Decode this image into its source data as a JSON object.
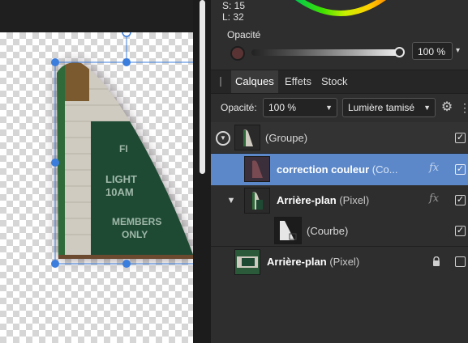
{
  "color_panel": {
    "saturation": "S: 15",
    "lightness": "L: 32",
    "opacity_label": "Opacité",
    "opacity_value": "100 %",
    "opacity_fraction": 1.0,
    "swatch_color": "#5a3434"
  },
  "tabs": [
    {
      "label": "Calques",
      "active": true
    },
    {
      "label": "Effets",
      "active": false
    },
    {
      "label": "Stock",
      "active": false
    }
  ],
  "layer_toolbar": {
    "opacity_label": "Opacité:",
    "opacity_value": "100 %",
    "blend_mode": "Lumière tamisé"
  },
  "layers": [
    {
      "name": "(Groupe)",
      "type": "",
      "checked": true,
      "selected": false
    },
    {
      "name": "correction couleur",
      "type": " (Co...",
      "fx": "fx",
      "checked": true,
      "selected": true
    },
    {
      "name": "Arrière-plan",
      "type": " (Pixel)",
      "fx": "fx",
      "checked": true,
      "selected": false
    },
    {
      "name": "(Courbe)",
      "type": "",
      "checked": true,
      "selected": false
    },
    {
      "name": "Arrière-plan",
      "type": " (Pixel)",
      "locked": true,
      "checked": false,
      "selected": false
    }
  ],
  "canvas_sign": {
    "line1": "FI",
    "line2": "LIGHT",
    "line3": "10AM",
    "line4": "MEMBERS",
    "line5": "ONLY"
  },
  "colors": {
    "accent_selected": "#5c88c9",
    "handle": "#3b7ddd"
  }
}
